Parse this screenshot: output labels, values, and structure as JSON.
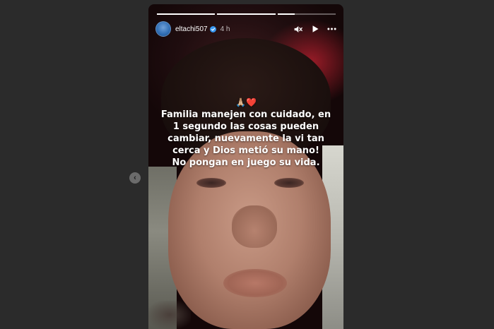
{
  "story": {
    "username": "eltachi507",
    "time_ago": "4 h",
    "progress": [
      1.0,
      1.0,
      0.3
    ],
    "emoji_line": "🙏🏼❤️",
    "caption_lines": [
      "Familia manejen con cuidado, en",
      "1 segundo las cosas pueden",
      "cambiar, nuevamente la vi tan",
      "cerca y Dios metió su mano!",
      "No pongan en juego su vida."
    ]
  },
  "icons": {
    "prev": "chevron-left-icon",
    "verified": "verified-badge-icon",
    "mute": "speaker-muted-icon",
    "play": "play-icon",
    "more": "more-options-icon"
  },
  "colors": {
    "page_background": "#2b2b2b",
    "verified_blue": "#3897f0",
    "accent_red": "#ff2a3c"
  }
}
